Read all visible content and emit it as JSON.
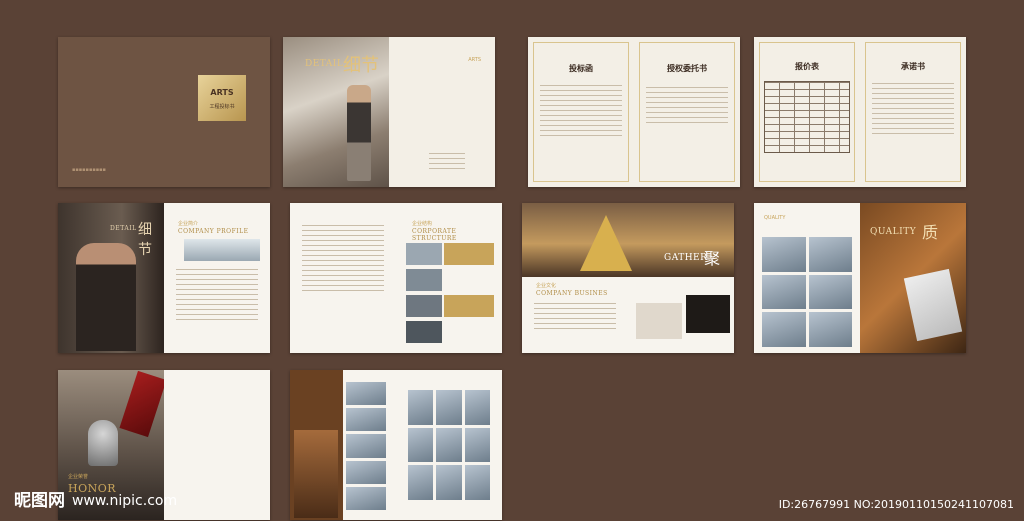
{
  "brochure": {
    "cover": {
      "logo_text": "ARTS",
      "logo_sub": "工程投标书"
    },
    "detail1": {
      "en": "DETAIL",
      "cn": "细节"
    },
    "forms": {
      "bid_letter": "投标函",
      "authorization": "授权委托书",
      "quotation": "报价表",
      "commitment": "承诺书"
    },
    "detail2": {
      "en": "DETAIL",
      "cn": "细节"
    },
    "profile": {
      "cn": "企业简介",
      "en": "COMPANY PROFILE"
    },
    "structure": {
      "cn": "企业结构",
      "en": "CORPORATE STRUCTURE"
    },
    "gather": {
      "en": "GATHER",
      "cn": "聚",
      "culture_cn": "企业文化",
      "culture_en": "COMPANY BUSINES"
    },
    "quality": {
      "en": "QUALITY",
      "cn": "质"
    },
    "honor": {
      "cn": "企业荣誉",
      "en": "HONOR"
    }
  },
  "watermark": {
    "site_cn": "昵图网",
    "site_url": "www.nipic.com",
    "id_text": "ID:26767991 NO:20190110150241107081"
  }
}
